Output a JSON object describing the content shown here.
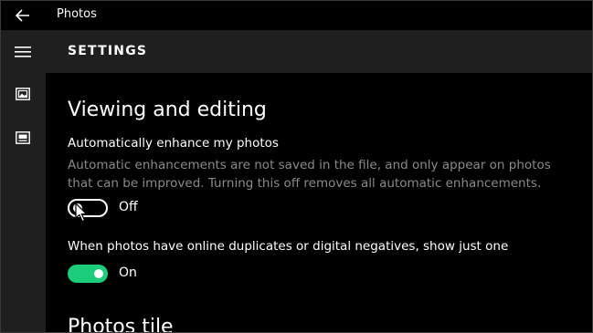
{
  "app": {
    "title": "Photos"
  },
  "titlebar": {
    "back_icon": "back-arrow-icon"
  },
  "rail": {
    "items": [
      {
        "icon": "hamburger-menu-icon"
      },
      {
        "icon": "collection-icon"
      },
      {
        "icon": "albums-icon"
      }
    ]
  },
  "header": {
    "title": "SETTINGS"
  },
  "viewing": {
    "section_title": "Viewing and editing",
    "enhance": {
      "label": "Automatically enhance my photos",
      "description": "Automatic enhancements are not saved in the file, and only appear on photos that can be improved. Turning this off removes all automatic enhancements.",
      "state": "Off",
      "value": false
    },
    "duplicates": {
      "label": "When photos have online duplicates or digital negatives, show just one",
      "state": "On",
      "value": true
    }
  },
  "tile": {
    "section_title": "Photos tile"
  },
  "colors": {
    "accent": "#1bcd7b",
    "background": "#000000",
    "panel": "#1f1f1f",
    "secondary_text": "#8a8a8a"
  }
}
